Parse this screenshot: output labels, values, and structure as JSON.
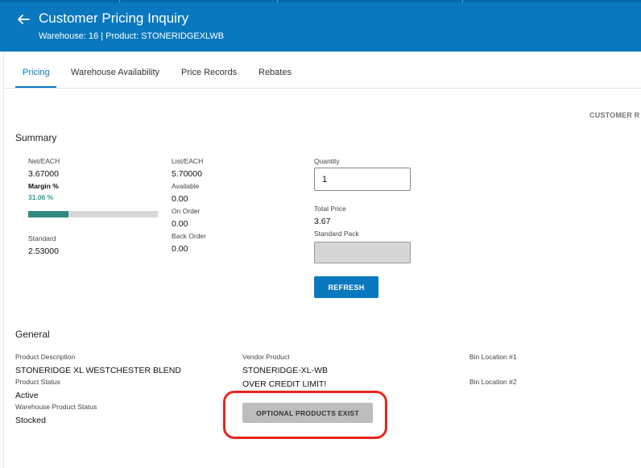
{
  "header": {
    "title": "Customer Pricing Inquiry",
    "subtitle": "Warehouse: 16 | Product: STONERIDGEXLWB"
  },
  "tabs": [
    {
      "label": "Pricing",
      "active": true
    },
    {
      "label": "Warehouse Availability",
      "active": false
    },
    {
      "label": "Price Records",
      "active": false
    },
    {
      "label": "Rebates",
      "active": false
    }
  ],
  "customer_ref_label": "CUSTOMER R",
  "summary": {
    "title": "Summary",
    "net_label": "Net/EACH",
    "net_value": "3.67000",
    "margin_label": "Margin %",
    "margin_value": "31.06 %",
    "margin_fraction": 0.3106,
    "standard_label": "Standard",
    "standard_value": "2.53000",
    "list_label": "List/EACH",
    "list_value": "5.70000",
    "available_label": "Available",
    "available_value": "0.00",
    "on_order_label": "On Order",
    "on_order_value": "0.00",
    "back_order_label": "Back Order",
    "back_order_value": "0.00",
    "quantity_label": "Quantity",
    "quantity_value": "1",
    "total_price_label": "Total Price",
    "total_price_value": "3.67",
    "standard_pack_label": "Standard Pack",
    "standard_pack_value": "",
    "refresh_label": "REFRESH"
  },
  "general": {
    "title": "General",
    "product_description_label": "Product Description",
    "product_description_value": "STONERIDGE XL WESTCHESTER BLEND",
    "product_status_label": "Product Status",
    "product_status_value": "Active",
    "warehouse_product_status_label": "Warehouse Product Status",
    "warehouse_product_status_value": "Stocked",
    "vendor_product_label": "Vendor Product",
    "vendor_product_value": "STONERIDGE-XL-WB",
    "credit_warning": "OVER CREDIT LIMIT!",
    "optional_products_label": "OPTIONAL PRODUCTS EXIST",
    "bin_location_1_label": "Bin Location #1",
    "bin_location_2_label": "Bin Location #2"
  },
  "colors": {
    "header_bg": "#0a78bf",
    "accent": "#0a78bf",
    "margin_text": "#2a9d8f",
    "margin_bar": "#2e8b7e",
    "highlight": "#e8261e"
  }
}
